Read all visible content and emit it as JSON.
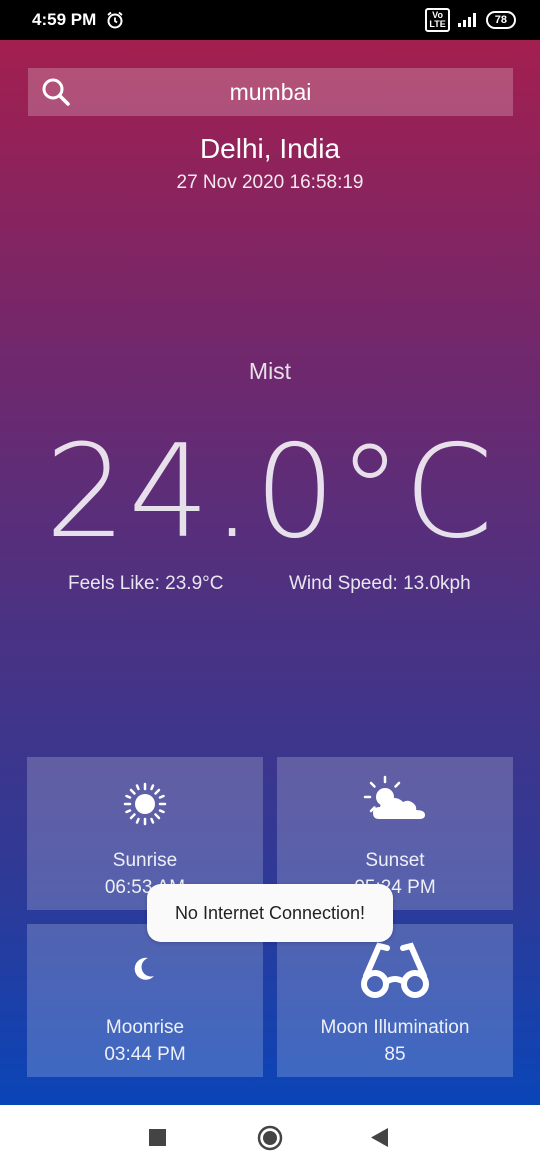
{
  "status_bar": {
    "time": "4:59 PM",
    "network": "VoLTE",
    "battery": "78"
  },
  "search": {
    "value": "mumbai"
  },
  "location": "Delhi, India",
  "datetime": "27 Nov 2020 16:58:19",
  "condition": "Mist",
  "temperature": "24.0°C",
  "feels_like": "Feels Like: 23.9°C",
  "wind_speed": "Wind Speed: 13.0kph",
  "cards": {
    "sunrise": {
      "label": "Sunrise",
      "value": "06:53 AM",
      "icon": "sun-icon"
    },
    "sunset": {
      "label": "Sunset",
      "value": "05:24 PM",
      "icon": "sun-cloud-icon"
    },
    "moonrise": {
      "label": "Moonrise",
      "value": "03:44 PM",
      "icon": "moon-icon"
    },
    "moon_illumination": {
      "label": "Moon Illumination",
      "value": "85",
      "icon": "glasses-icon"
    }
  },
  "toast": "No Internet Connection!",
  "colors": {
    "gradient_top": "#a31f4f",
    "gradient_bottom": "#0a45b8"
  }
}
